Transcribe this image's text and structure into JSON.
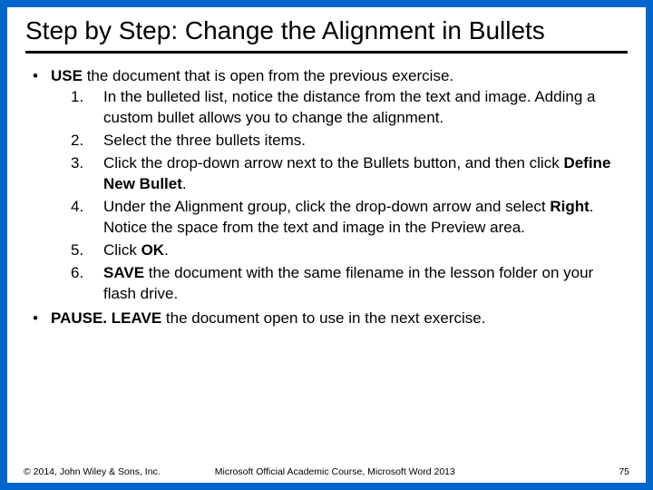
{
  "title": "Step by Step: Change the Alignment in Bullets",
  "bullets": [
    {
      "prefix_bold": "USE",
      "prefix_rest": " the document that is open from the previous exercise.",
      "steps": [
        {
          "n": "1.",
          "plain_before": "In the bulleted list, notice the distance from the text and image. Adding a custom bullet allows you to change the alignment."
        },
        {
          "n": "2.",
          "plain_before": "Select the three bullets items."
        },
        {
          "n": "3.",
          "plain_before": "Click the drop-down arrow next to the Bullets button, and then click ",
          "bold": "Define New Bullet",
          "plain_after": "."
        },
        {
          "n": "4.",
          "plain_before": "Under the Alignment group, click the drop-down arrow and select ",
          "bold": "Right",
          "plain_after": ". Notice the space from the text and image in the Preview area."
        },
        {
          "n": "5.",
          "plain_before": "Click ",
          "bold": "OK",
          "plain_after": "."
        },
        {
          "n": "6.",
          "lead_space": " ",
          "bold_first": "SAVE",
          "plain_after": " the document with the same filename in the lesson folder on your flash drive."
        }
      ]
    },
    {
      "prefix_bold": "PAUSE. LEAVE",
      "prefix_rest": " the document open to use in the next exercise."
    }
  ],
  "footer": {
    "copyright": "© 2014, John Wiley & Sons, Inc.",
    "center": "Microsoft Official Academic Course, Microsoft Word 2013",
    "page": "75"
  }
}
